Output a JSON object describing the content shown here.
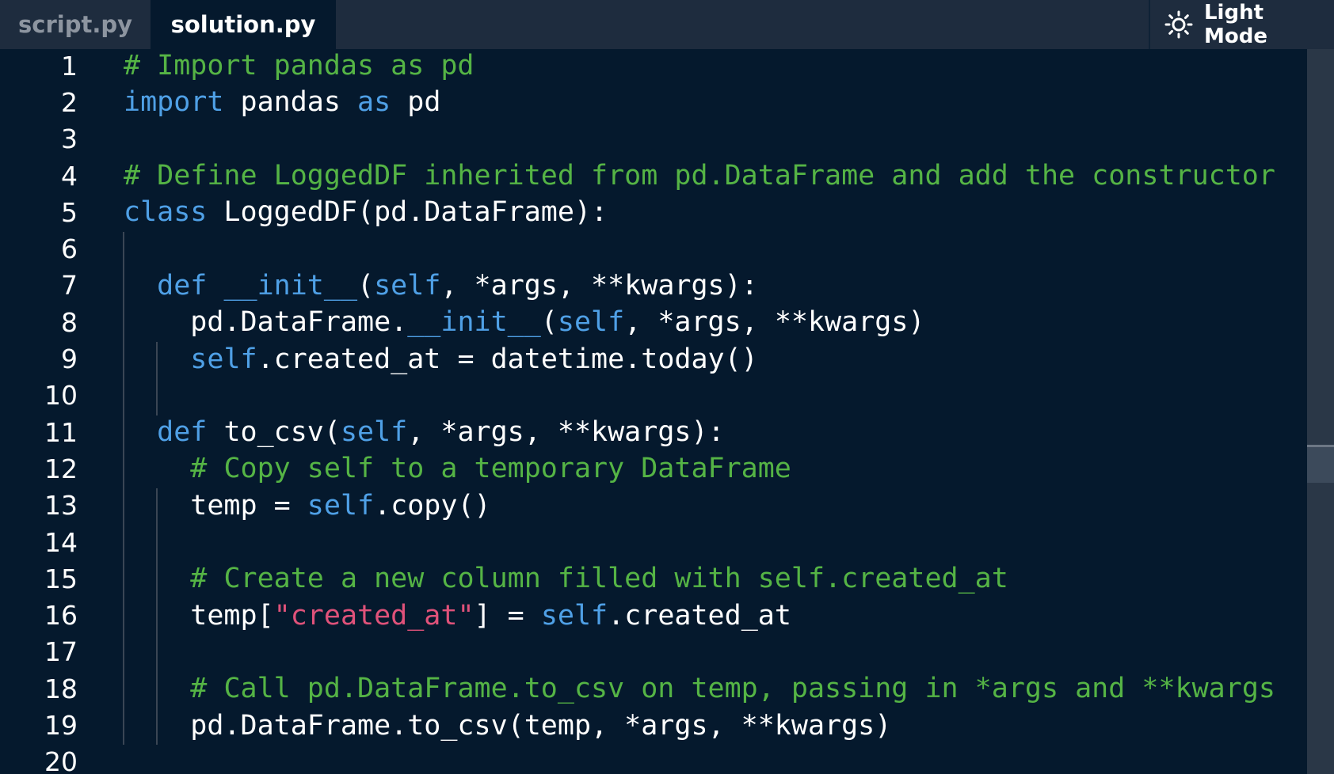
{
  "tabs": [
    {
      "label": "script.py",
      "active": false
    },
    {
      "label": "solution.py",
      "active": true
    }
  ],
  "mode_toggle": {
    "label": "Light Mode",
    "icon": "sun-icon"
  },
  "colors": {
    "background": "#05192d",
    "tabbar": "#1e2c3e",
    "comment": "#55b445",
    "keyword": "#4fa0e6",
    "string": "#e0527a",
    "text": "#ffffff"
  },
  "code_lines": [
    {
      "number": "1",
      "tokens": [
        {
          "t": "# Import pandas as pd",
          "c": "comment"
        }
      ]
    },
    {
      "number": "2",
      "tokens": [
        {
          "t": "import",
          "c": "kw"
        },
        {
          "t": " pandas ",
          "c": "plain"
        },
        {
          "t": "as",
          "c": "kw"
        },
        {
          "t": " pd",
          "c": "plain"
        }
      ]
    },
    {
      "number": "3",
      "tokens": []
    },
    {
      "number": "4",
      "tokens": [
        {
          "t": "# Define LoggedDF inherited from pd.DataFrame and add the constructor",
          "c": "comment"
        }
      ]
    },
    {
      "number": "5",
      "tokens": [
        {
          "t": "class",
          "c": "kw"
        },
        {
          "t": " LoggedDF(pd.DataFrame):",
          "c": "plain"
        }
      ]
    },
    {
      "number": "6",
      "tokens": []
    },
    {
      "number": "7",
      "tokens": [
        {
          "t": "  ",
          "c": "plain"
        },
        {
          "t": "def",
          "c": "kw"
        },
        {
          "t": " ",
          "c": "plain"
        },
        {
          "t": "__init__",
          "c": "kw"
        },
        {
          "t": "(",
          "c": "plain"
        },
        {
          "t": "self",
          "c": "self"
        },
        {
          "t": ", *args, **kwargs):",
          "c": "plain"
        }
      ]
    },
    {
      "number": "8",
      "tokens": [
        {
          "t": "    pd.DataFrame.",
          "c": "plain"
        },
        {
          "t": "__init__",
          "c": "kw"
        },
        {
          "t": "(",
          "c": "plain"
        },
        {
          "t": "self",
          "c": "self"
        },
        {
          "t": ", *args, **kwargs)",
          "c": "plain"
        }
      ]
    },
    {
      "number": "9",
      "tokens": [
        {
          "t": "    ",
          "c": "plain"
        },
        {
          "t": "self",
          "c": "self"
        },
        {
          "t": ".created_at = datetime.today()",
          "c": "plain"
        }
      ]
    },
    {
      "number": "10",
      "tokens": []
    },
    {
      "number": "11",
      "tokens": [
        {
          "t": "  ",
          "c": "plain"
        },
        {
          "t": "def",
          "c": "kw"
        },
        {
          "t": " to_csv(",
          "c": "plain"
        },
        {
          "t": "self",
          "c": "self"
        },
        {
          "t": ", *args, **kwargs):",
          "c": "plain"
        }
      ]
    },
    {
      "number": "12",
      "tokens": [
        {
          "t": "    ",
          "c": "plain"
        },
        {
          "t": "# Copy self to a temporary DataFrame",
          "c": "comment"
        }
      ]
    },
    {
      "number": "13",
      "tokens": [
        {
          "t": "    temp = ",
          "c": "plain"
        },
        {
          "t": "self",
          "c": "self"
        },
        {
          "t": ".copy()",
          "c": "plain"
        }
      ]
    },
    {
      "number": "14",
      "tokens": []
    },
    {
      "number": "15",
      "tokens": [
        {
          "t": "    ",
          "c": "plain"
        },
        {
          "t": "# Create a new column filled with self.created_at",
          "c": "comment"
        }
      ]
    },
    {
      "number": "16",
      "tokens": [
        {
          "t": "    temp[",
          "c": "plain"
        },
        {
          "t": "\"created_at\"",
          "c": "str"
        },
        {
          "t": "] = ",
          "c": "plain"
        },
        {
          "t": "self",
          "c": "self"
        },
        {
          "t": ".created_at",
          "c": "plain"
        }
      ]
    },
    {
      "number": "17",
      "tokens": []
    },
    {
      "number": "18",
      "tokens": [
        {
          "t": "    ",
          "c": "plain"
        },
        {
          "t": "# Call pd.DataFrame.to_csv on temp, passing in *args and **kwargs",
          "c": "comment"
        }
      ]
    },
    {
      "number": "19",
      "tokens": [
        {
          "t": "    pd.DataFrame.to_csv(temp, *args, **kwargs)",
          "c": "plain"
        }
      ]
    },
    {
      "number": "20",
      "tokens": []
    }
  ]
}
